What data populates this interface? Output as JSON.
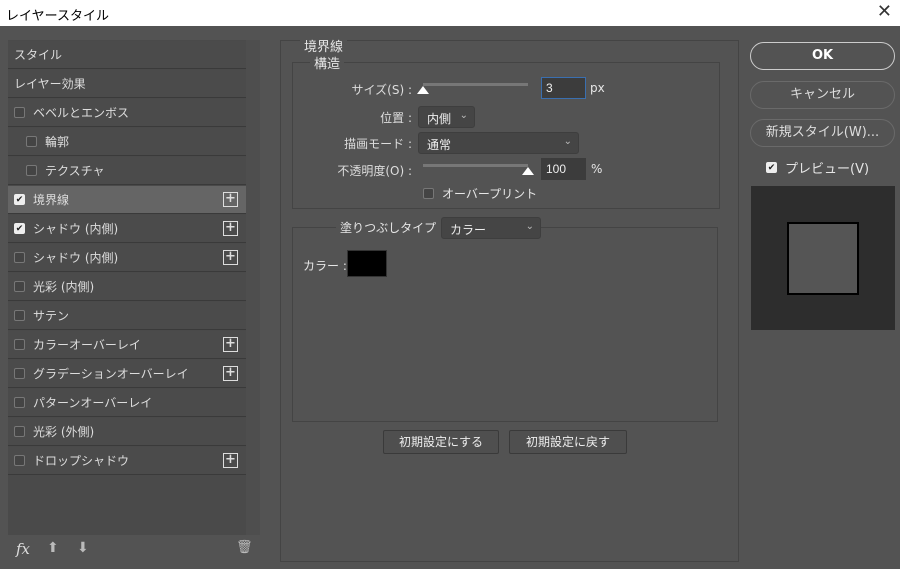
{
  "window": {
    "title": "レイヤースタイル",
    "close": "✕"
  },
  "sidebar": {
    "items": [
      {
        "label": "スタイル",
        "checkbox": false,
        "checked": false,
        "plus": false,
        "selected": false,
        "indent": false
      },
      {
        "label": "レイヤー効果",
        "checkbox": false,
        "checked": false,
        "plus": false,
        "selected": false,
        "indent": false
      },
      {
        "label": "ベベルとエンボス",
        "checkbox": true,
        "checked": false,
        "plus": false,
        "selected": false,
        "indent": false
      },
      {
        "label": "輪郭",
        "checkbox": true,
        "checked": false,
        "plus": false,
        "selected": false,
        "indent": true
      },
      {
        "label": "テクスチャ",
        "checkbox": true,
        "checked": false,
        "plus": false,
        "selected": false,
        "indent": true
      },
      {
        "label": "境界線",
        "checkbox": true,
        "checked": true,
        "plus": true,
        "selected": true,
        "indent": false
      },
      {
        "label": "シャドウ (内側)",
        "checkbox": true,
        "checked": true,
        "plus": true,
        "selected": false,
        "indent": false
      },
      {
        "label": "シャドウ (内側)",
        "checkbox": true,
        "checked": false,
        "plus": true,
        "selected": false,
        "indent": false
      },
      {
        "label": "光彩 (内側)",
        "checkbox": true,
        "checked": false,
        "plus": false,
        "selected": false,
        "indent": false
      },
      {
        "label": "サテン",
        "checkbox": true,
        "checked": false,
        "plus": false,
        "selected": false,
        "indent": false
      },
      {
        "label": "カラーオーバーレイ",
        "checkbox": true,
        "checked": false,
        "plus": true,
        "selected": false,
        "indent": false
      },
      {
        "label": "グラデーションオーバーレイ",
        "checkbox": true,
        "checked": false,
        "plus": true,
        "selected": false,
        "indent": false
      },
      {
        "label": "パターンオーバーレイ",
        "checkbox": true,
        "checked": false,
        "plus": false,
        "selected": false,
        "indent": false
      },
      {
        "label": "光彩 (外側)",
        "checkbox": true,
        "checked": false,
        "plus": false,
        "selected": false,
        "indent": false
      },
      {
        "label": "ドロップシャドウ",
        "checkbox": true,
        "checked": false,
        "plus": true,
        "selected": false,
        "indent": false
      }
    ],
    "bottom": {
      "fx": "fx",
      "up": "⬆",
      "down": "⬇",
      "trash": "🗑"
    }
  },
  "stroke": {
    "title": "境界線",
    "structure": "構造",
    "size_label": "サイズ(S) :",
    "size_value": "3",
    "size_unit": "px",
    "size_fraction": 0.0,
    "position_label": "位置 :",
    "position_value": "内側",
    "blend_label": "描画モード :",
    "blend_value": "通常",
    "opacity_label": "不透明度(O) :",
    "opacity_value": "100",
    "opacity_unit": "%",
    "opacity_fraction": 1.0,
    "overprint_label": "オーバープリント",
    "fill_type_label": "塗りつぶしタイプ :",
    "fill_type_value": "カラー",
    "color_label": "カラー :",
    "color": "#000000",
    "make_default": "初期設定にする",
    "reset_default": "初期設定に戻す"
  },
  "right": {
    "ok": "OK",
    "cancel": "キャンセル",
    "new_style": "新規スタイル(W)...",
    "preview_label": "プレビュー(V)",
    "preview_checked": true
  }
}
